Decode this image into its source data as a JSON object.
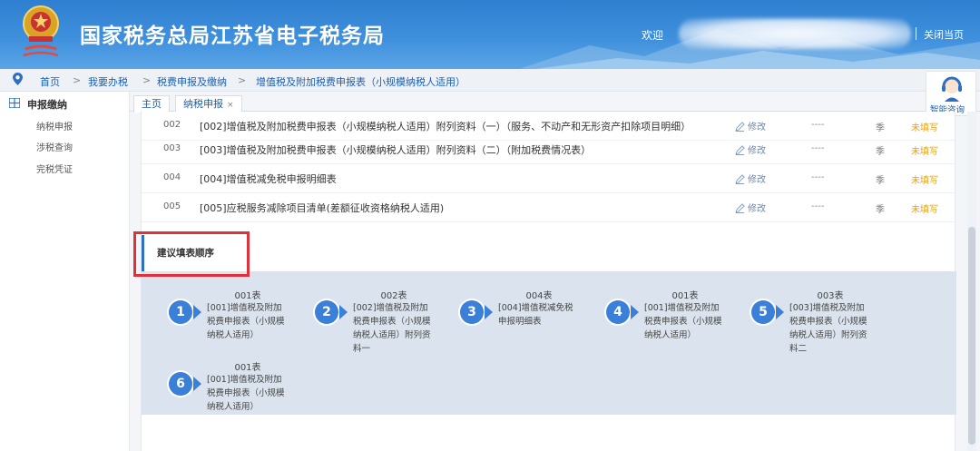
{
  "header": {
    "title": "国家税务总局江苏省电子税务局",
    "welcome": "欢迎",
    "close_page": "关闭当页"
  },
  "breadcrumb": {
    "items": [
      "首页",
      "我要办税",
      "税费申报及缴纳",
      "增值税及附加税费申报表（小规模纳税人适用）"
    ],
    "separator": ">"
  },
  "sidebar": {
    "heading": "申报缴纳",
    "items": [
      "纳税申报",
      "涉税查询",
      "完税凭证"
    ]
  },
  "tabs": [
    {
      "label": "主页"
    },
    {
      "label": "纳税申报",
      "close": "×"
    }
  ],
  "help": {
    "label": "智能咨询"
  },
  "forms": [
    {
      "num": "002",
      "name": "[002]增值税及附加税费申报表（小规模纳税人适用）附列资料（一）（服务、不动产和无形资产扣除项目明细）",
      "edit": "修改",
      "dash": "----",
      "period": "季",
      "status": "未填写"
    },
    {
      "num": "003",
      "name": "[003]增值税及附加税费申报表（小规模纳税人适用）附列资料（二）（附加税费情况表）",
      "edit": "修改",
      "dash": "----",
      "period": "季",
      "status": "未填写"
    },
    {
      "num": "004",
      "name": "[004]增值税减免税申报明细表",
      "edit": "修改",
      "dash": "----",
      "period": "季",
      "status": "未填写"
    },
    {
      "num": "005",
      "name": "[005]应税服务减除项目清单(差额征收资格纳税人适用)",
      "edit": "修改",
      "dash": "----",
      "period": "季",
      "status": "未填写"
    }
  ],
  "order_section": {
    "title": "建议填表顺序",
    "steps": [
      {
        "n": "1",
        "code": "001表",
        "desc": "[001]增值税及附加税费申报表（小规模纳税人适用）"
      },
      {
        "n": "2",
        "code": "002表",
        "desc": "[002]增值税及附加税费申报表（小规模纳税人适用）附列资料一"
      },
      {
        "n": "3",
        "code": "004表",
        "desc": "[004]增值税减免税申报明细表"
      },
      {
        "n": "4",
        "code": "001表",
        "desc": "[001]增值税及附加税费申报表（小规模纳税人适用）"
      },
      {
        "n": "5",
        "code": "003表",
        "desc": "[003]增值税及附加税费申报表（小规模纳税人适用）附列资料二"
      },
      {
        "n": "6",
        "code": "001表",
        "desc": "[001]增值税及附加税费申报表（小规模纳税人适用）"
      }
    ]
  },
  "colors": {
    "brand": "#2f7fd0",
    "accent": "#3b80d8",
    "pending": "#e0a21b",
    "highlight": "#e0313a"
  }
}
